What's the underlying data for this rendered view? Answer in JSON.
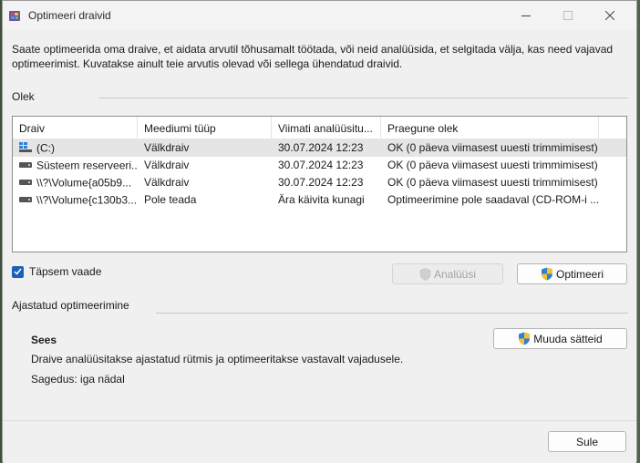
{
  "window": {
    "title": "Optimeeri draivid",
    "description": "Saate optimeerida oma draive, et aidata arvutil tõhusamalt töötada, või neid analüüsida, et selgitada välja, kas need vajavad optimeerimist. Kuvatakse ainult teie arvutis olevad või sellega ühendatud draivid."
  },
  "status_section": {
    "label": "Olek",
    "columns": [
      "Draiv",
      "Meediumi tüüp",
      "Viimati analüüsitu...",
      "Praegune olek"
    ],
    "rows": [
      {
        "icon": "windows-drive-icon",
        "drive": "(C:)",
        "media": "Välkdraiv",
        "last": "30.07.2024 12:23",
        "status": "OK (0 päeva viimasest uuesti trimmimisest)"
      },
      {
        "icon": "drive-icon",
        "drive": "Süsteem reserveeri...",
        "media": "Välkdraiv",
        "last": "30.07.2024 12:23",
        "status": "OK (0 päeva viimasest uuesti trimmimisest)"
      },
      {
        "icon": "drive-icon",
        "drive": "\\\\?\\Volume{a05b9...",
        "media": "Välkdraiv",
        "last": "30.07.2024 12:23",
        "status": "OK (0 päeva viimasest uuesti trimmimisest)"
      },
      {
        "icon": "drive-icon",
        "drive": "\\\\?\\Volume{c130b3...",
        "media": "Pole teada",
        "last": "Ära käivita kunagi",
        "status": "Optimeerimine pole saadaval (CD-ROM-i ..."
      }
    ],
    "advanced_view_label": "Täpsem vaade",
    "advanced_view_checked": true,
    "analyze_label": "Analüüsi",
    "optimize_label": "Optimeeri"
  },
  "schedule_section": {
    "label": "Ajastatud optimeerimine",
    "state": "Sees",
    "description": "Draive analüüsitakse ajastatud rütmis ja optimeeritakse vastavalt vajadusele.",
    "frequency": "Sagedus: iga nädal",
    "change_settings_label": "Muuda sätteid"
  },
  "footer": {
    "close_label": "Sule"
  },
  "colors": {
    "accent": "#1e5fb8",
    "selection": "#e5e5e5"
  }
}
